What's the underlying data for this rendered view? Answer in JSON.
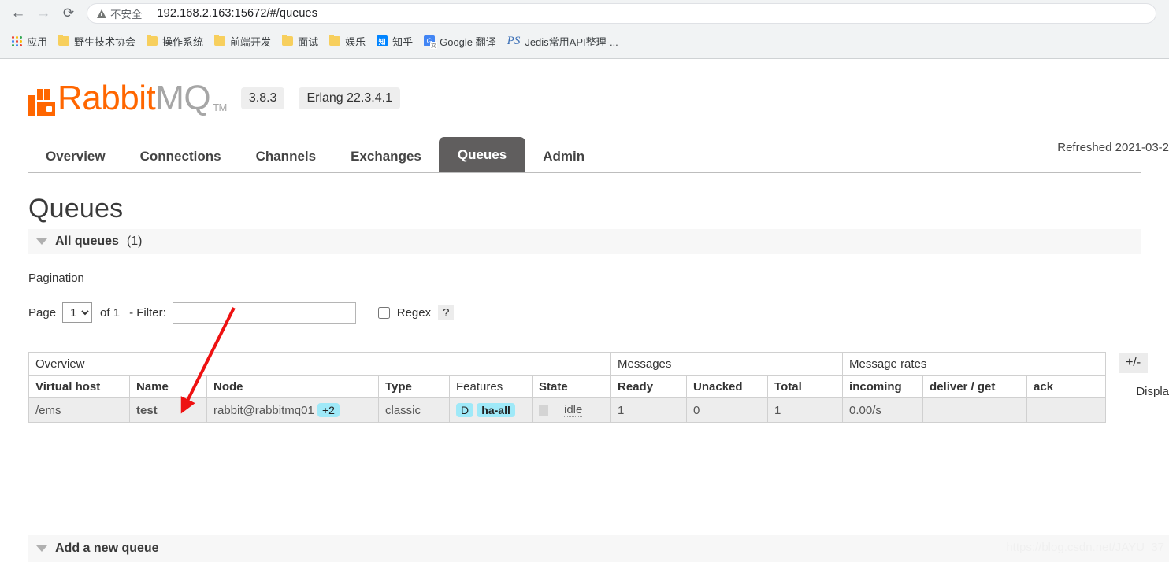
{
  "browser": {
    "back_icon": "back-arrow-icon",
    "forward_icon": "forward-arrow-icon",
    "reload_icon": "reload-icon",
    "security_label": "不安全",
    "url": "192.168.2.163:15672/#/queues",
    "bookmarks": [
      {
        "label": "应用",
        "icon": "apps-grid-icon"
      },
      {
        "label": "野生技术协会",
        "icon": "folder-icon"
      },
      {
        "label": "操作系统",
        "icon": "folder-icon"
      },
      {
        "label": "前端开发",
        "icon": "folder-icon"
      },
      {
        "label": "面试",
        "icon": "folder-icon"
      },
      {
        "label": "娱乐",
        "icon": "folder-icon"
      },
      {
        "label": "知乎",
        "icon": "zhihu-icon",
        "icon_text": "知"
      },
      {
        "label": "Google 翻译",
        "icon": "google-translate-icon",
        "icon_text": "G"
      },
      {
        "label": "Jedis常用API整理-...",
        "icon": "ps-icon",
        "icon_text": "PS"
      }
    ]
  },
  "header": {
    "logo_rabbit": "Rabbit",
    "logo_mq": "MQ",
    "logo_tm": "TM",
    "version": "3.8.3",
    "erlang_version": "Erlang 22.3.4.1",
    "refreshed": "Refreshed 2021-03-2"
  },
  "nav": {
    "tabs": [
      {
        "label": "Overview",
        "active": false
      },
      {
        "label": "Connections",
        "active": false
      },
      {
        "label": "Channels",
        "active": false
      },
      {
        "label": "Exchanges",
        "active": false
      },
      {
        "label": "Queues",
        "active": true
      },
      {
        "label": "Admin",
        "active": false
      }
    ]
  },
  "main": {
    "page_title": "Queues",
    "all_queues_label": "All queues",
    "all_queues_count": "(1)",
    "pagination_label": "Pagination",
    "page_label": "Page",
    "page_value": "1",
    "page_options": [
      "1"
    ],
    "of_label": "of 1",
    "filter_label": "- Filter:",
    "filter_value": "",
    "filter_placeholder": "",
    "regex_label": "Regex",
    "regex_checked": false,
    "help_label": "?",
    "displaying_label": "Displa",
    "plusminus_label": "+/-",
    "add_queue_label": "Add a new queue",
    "watermark": "https://blog.csdn.net/JAYU_37"
  },
  "table": {
    "group_headers": [
      {
        "label": "Overview",
        "span": 6
      },
      {
        "label": "Messages",
        "span": 3
      },
      {
        "label": "Message rates",
        "span": 3
      }
    ],
    "columns": [
      {
        "label": "Virtual host",
        "bold": true
      },
      {
        "label": "Name",
        "bold": true
      },
      {
        "label": "Node",
        "bold": true
      },
      {
        "label": "Type",
        "bold": true
      },
      {
        "label": "Features",
        "bold": false
      },
      {
        "label": "State",
        "bold": true
      },
      {
        "label": "Ready",
        "bold": true
      },
      {
        "label": "Unacked",
        "bold": true
      },
      {
        "label": "Total",
        "bold": true
      },
      {
        "label": "incoming",
        "bold": true
      },
      {
        "label": "deliver / get",
        "bold": true
      },
      {
        "label": "ack",
        "bold": true
      }
    ],
    "rows": [
      {
        "virtual_host": "/ems",
        "name": "test",
        "node": "rabbit@rabbitmq01",
        "node_badge": "+2",
        "type": "classic",
        "feature_d": "D",
        "feature_ha": "ha-all",
        "state": "idle",
        "ready": "1",
        "unacked": "0",
        "total": "1",
        "incoming": "0.00/s",
        "deliver_get": "",
        "ack": ""
      }
    ]
  },
  "annotation": {
    "arrow_color": "#ee1111"
  }
}
